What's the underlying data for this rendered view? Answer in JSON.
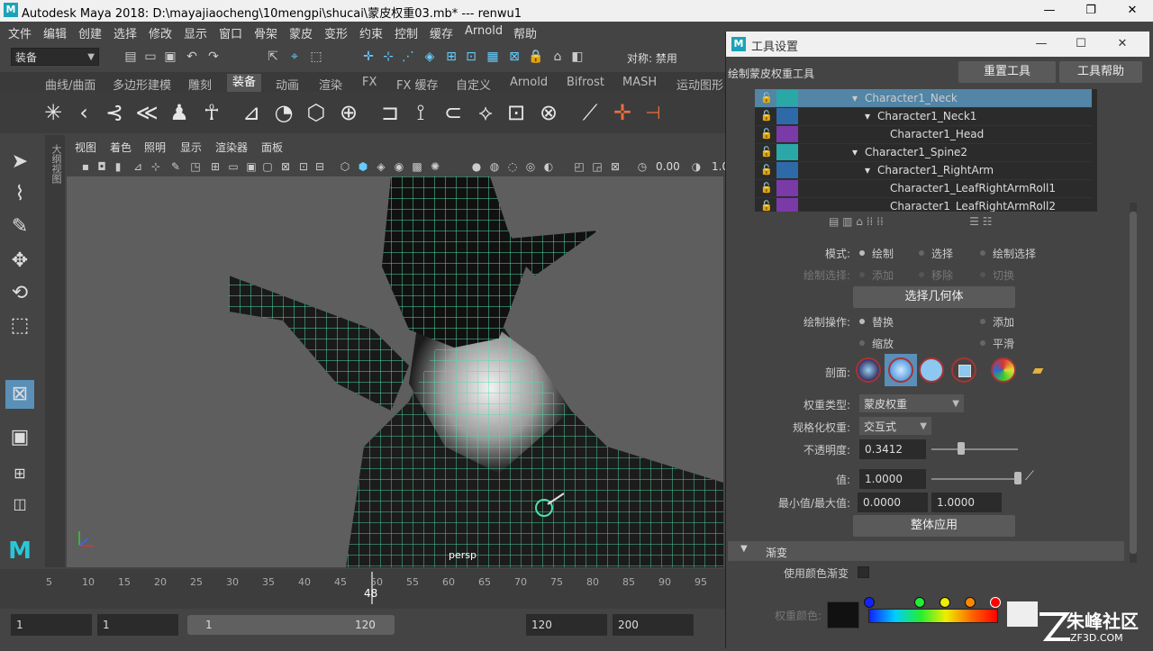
{
  "window": {
    "logo": "M",
    "title": "Autodesk Maya 2018: D:\\mayajiaocheng\\10mengpi\\shucai\\蒙皮权重03.mb*   ---   renwu1",
    "min": "—",
    "max": "❐",
    "close": "✕"
  },
  "menu": [
    "文件",
    "编辑",
    "创建",
    "选择",
    "修改",
    "显示",
    "窗口",
    "骨架",
    "蒙皮",
    "变形",
    "约束",
    "控制",
    "缓存",
    "Arnold",
    "帮助"
  ],
  "status": {
    "mode_dropdown": "装备",
    "symmetry": "对称: 禁用"
  },
  "shelf_tabs": [
    "曲线/曲面",
    "多边形建模",
    "雕刻",
    "装备",
    "动画",
    "渲染",
    "FX",
    "FX 缓存",
    "自定义",
    "Arnold",
    "Bifrost",
    "MASH",
    "运动图形"
  ],
  "active_shelf_tab": "装备",
  "side_strip_label": "大纲视图",
  "viewport_menu": [
    "视图",
    "着色",
    "照明",
    "显示",
    "渲染器",
    "面板"
  ],
  "viewport_values": {
    "exposure": "0.00",
    "gamma": "1.0"
  },
  "viewport_camera": "persp",
  "timeline": {
    "ticks": [
      "5",
      "10",
      "15",
      "20",
      "25",
      "30",
      "35",
      "40",
      "45",
      "50",
      "55",
      "60",
      "65",
      "70",
      "75",
      "80",
      "85",
      "90",
      "95"
    ],
    "current_frame": "48"
  },
  "range": {
    "start": "1",
    "anim_start": "1",
    "slider_start": "1",
    "slider_end": "120",
    "end": "120",
    "anim_end": "200"
  },
  "panel": {
    "title": "工具设置",
    "min": "—",
    "max": "☐",
    "close": "✕",
    "tool_name": "绘制蒙皮权重工具",
    "reset_btn": "重置工具",
    "help_btn": "工具帮助",
    "joints": [
      {
        "name": "Character1_Neck",
        "indent": 1,
        "color": "#2aa8a8",
        "selected": true,
        "expand": "▾"
      },
      {
        "name": "Character1_Neck1",
        "indent": 2,
        "color": "#2f6aa8",
        "selected": false,
        "expand": "▾"
      },
      {
        "name": "Character1_Head",
        "indent": 3,
        "color": "#7a3aa8",
        "selected": false,
        "expand": ""
      },
      {
        "name": "Character1_Spine2",
        "indent": 1,
        "color": "#2aa8a8",
        "selected": false,
        "expand": "▾"
      },
      {
        "name": "Character1_RightArm",
        "indent": 2,
        "color": "#2f6aa8",
        "selected": false,
        "expand": "▾"
      },
      {
        "name": "Character1_LeafRightArmRoll1",
        "indent": 3,
        "color": "#7a3aa8",
        "selected": false,
        "expand": ""
      },
      {
        "name": "Character1_LeafRightArmRoll2",
        "indent": 3,
        "color": "#7a3aa8",
        "selected": false,
        "expand": ""
      }
    ],
    "mode_label": "模式:",
    "mode_options": [
      "绘制",
      "选择",
      "绘制选择"
    ],
    "paint_select_label": "绘制选择:",
    "paint_select_options": [
      "添加",
      "移除",
      "切换"
    ],
    "select_geometry_btn": "选择几何体",
    "paint_op_label": "绘制操作:",
    "paint_ops": [
      "替换",
      "添加",
      "缩放",
      "平滑"
    ],
    "profile_label": "剖面:",
    "weight_type_label": "权重类型:",
    "weight_type_value": "蒙皮权重",
    "normalize_label": "规格化权重:",
    "normalize_value": "交互式",
    "opacity_label": "不透明度:",
    "opacity_value": "0.3412",
    "opacity_fraction": 0.3412,
    "value_label": "值:",
    "value_value": "1.0000",
    "value_fraction": 1.0,
    "minmax_label": "最小值/最大值:",
    "min_value": "0.0000",
    "max_value": "1.0000",
    "flood_btn": "整体应用",
    "gradient_section": "渐变",
    "use_color_ramp_label": "使用颜色渐变",
    "weight_color_label": "权重颜色:"
  },
  "watermark": {
    "text": "朱峰社区",
    "sub": "ZF3D.COM"
  }
}
